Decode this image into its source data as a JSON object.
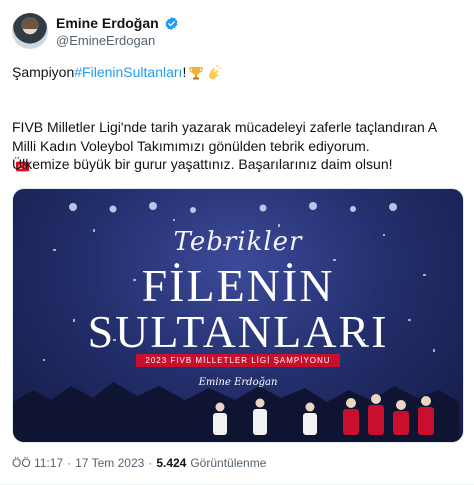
{
  "author": {
    "display_name": "Emine Erdoğan",
    "handle": "@EmineErdogan",
    "verified": true
  },
  "tweet": {
    "line1_prefix": "Şampiyon ",
    "hashtag": "#FileninSultanları",
    "line1_suffix": "!",
    "emojis": [
      "trophy-icon",
      "clapping-hands-icon",
      "turkish-flag-icon"
    ],
    "paragraph2": "FIVB Milletler Ligi'nde tarih yazarak mücadeleyi zaferle taçlandıran A Milli Kadın Voleybol Takımımızı gönülden tebrik ediyorum.",
    "paragraph3": "Ülkemize büyük bir gurur yaşattınız. Başarılarınız daim olsun!"
  },
  "media": {
    "heading_script": "Tebrikler",
    "title_line1": "FİLENİN",
    "title_line2": "SULTANLARI",
    "ribbon": "2023 FIVB MİLLETLER LİGİ ŞAMPİYONU",
    "signature": "Emine Erdoğan"
  },
  "meta": {
    "time": "ÖÖ 11:17",
    "separator": "·",
    "date": "17 Tem 2023",
    "views_count": "5.424",
    "views_label": "Görüntülenme"
  },
  "colors": {
    "accent": "#1d9bf0",
    "text": "#0f1419",
    "muted": "#536471",
    "ribbon": "#c8102e"
  }
}
